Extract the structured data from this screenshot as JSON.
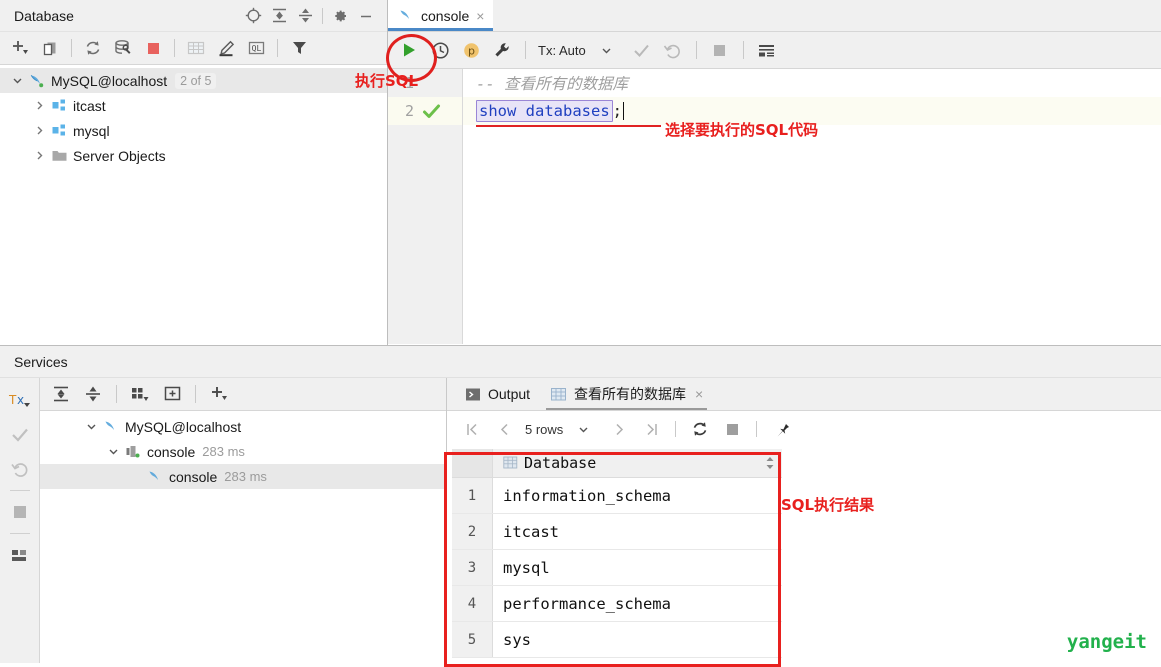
{
  "database_panel": {
    "title": "Database",
    "header_icons": [
      "locate-icon",
      "expand-all-icon",
      "collapse-all-icon",
      "settings-gear-icon",
      "hide-panel-icon"
    ],
    "toolbar_icons": [
      "add-icon",
      "duplicate-icon",
      "refresh-icon",
      "datasource-properties-icon",
      "stop-icon",
      "table-icon",
      "edit-icon",
      "query-console-icon",
      "filter-icon"
    ],
    "tree": [
      {
        "label": "MySQL@localhost",
        "badge": "2 of 5",
        "icon": "mysql-dolphin-icon",
        "expanded": true,
        "level": 0,
        "selected": true
      },
      {
        "label": "itcast",
        "icon": "schema-icon",
        "expanded": false,
        "level": 1,
        "selected": false
      },
      {
        "label": "mysql",
        "icon": "schema-icon",
        "expanded": false,
        "level": 1,
        "selected": false
      },
      {
        "label": "Server Objects",
        "icon": "folder-icon",
        "expanded": false,
        "level": 1,
        "selected": false
      }
    ]
  },
  "editor": {
    "tab": {
      "label": "console",
      "icon": "mysql-dolphin-icon",
      "close": "×"
    },
    "toolbar": {
      "run_title": "execute-icon",
      "history_title": "history-icon",
      "p_badge": "p",
      "wrench_title": "session-settings-icon",
      "tx_label": "Tx: Auto",
      "commit_title": "commit-icon",
      "rollback_title": "rollback-icon",
      "stop_title": "stop-icon",
      "params_title": "parameters-icon"
    },
    "lines": [
      {
        "number": "1",
        "status": "",
        "text": "-- 查看所有的数据库",
        "type": "comment",
        "highlighted": false
      },
      {
        "number": "2",
        "status": "check",
        "text": "show databases",
        "suffix": ";",
        "type": "sql",
        "highlighted": true
      }
    ]
  },
  "services": {
    "title": "Services",
    "rail_icons": [
      "tx-icon",
      "commit-icon",
      "rollback-icon",
      "stop-icon",
      "layout-icon"
    ],
    "toolbar_icons": [
      "expand-all-icon",
      "collapse-all-icon",
      "group-by-icon",
      "new-window-icon",
      "add-icon"
    ],
    "tree": [
      {
        "label": "MySQL@localhost",
        "time": "",
        "icon": "mysql-dolphin-icon",
        "level": 0,
        "expanded": true,
        "selected": false
      },
      {
        "label": "console",
        "time": "283 ms",
        "icon": "session-icon",
        "level": 1,
        "expanded": true,
        "selected": false
      },
      {
        "label": "console",
        "time": "283 ms",
        "icon": "mysql-dolphin-icon",
        "level": 2,
        "expanded": null,
        "selected": true
      }
    ]
  },
  "results": {
    "tabs": [
      {
        "label": "Output",
        "icon": "output-console-icon",
        "active": false,
        "closable": false
      },
      {
        "label": "查看所有的数据库",
        "icon": "result-table-icon",
        "active": true,
        "closable": true,
        "close": "×"
      }
    ],
    "toolbar": {
      "first_page": "first-page-icon",
      "prev_page": "prev-page-icon",
      "rows_label": "5 rows",
      "next_page": "next-page-icon",
      "last_page": "last-page-icon",
      "reload": "reload-icon",
      "stop": "stop-icon",
      "pin": "pin-icon"
    },
    "grid": {
      "column_icon": "column-table-icon",
      "column_name": "Database",
      "rows": [
        {
          "index": "1",
          "value": "information_schema"
        },
        {
          "index": "2",
          "value": "itcast"
        },
        {
          "index": "3",
          "value": "mysql"
        },
        {
          "index": "4",
          "value": "performance_schema"
        },
        {
          "index": "5",
          "value": "sys"
        }
      ]
    }
  },
  "annotations": {
    "run_sql": "执行SQL",
    "select_sql": "选择要执行的SQL代码",
    "sql_result": "SQL执行结果",
    "accent_color": "#e8201e"
  },
  "watermark": {
    "text": "yangeit",
    "color": "#22b14c"
  }
}
